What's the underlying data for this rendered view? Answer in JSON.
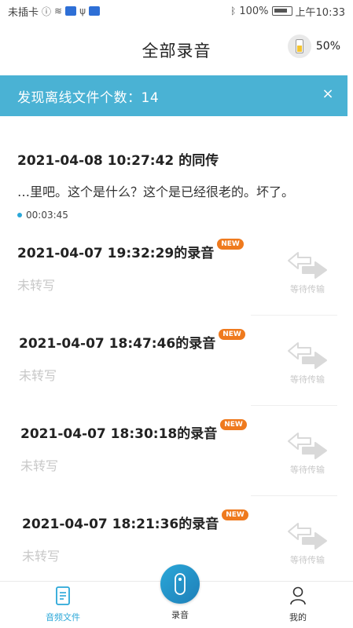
{
  "status_bar": {
    "carrier": "未插卡",
    "battery_percent": "100%",
    "time": "上午10:33"
  },
  "header": {
    "title": "全部录音",
    "device_battery": "50%",
    "device_battery_level": 0.5
  },
  "banner": {
    "text": "发现离线文件个数：14",
    "close_symbol": "×"
  },
  "first_record": {
    "title": "2021-04-08 10:27:42 的同传",
    "snippet": "…里吧。这个是什么？这个是已经很老的。坏了。",
    "duration": "00:03:45"
  },
  "records": [
    {
      "title": "2021-04-07 19:32:29的录音",
      "badge": "NEW",
      "status": "未转写",
      "transfer": "等待传输"
    },
    {
      "title": "2021-04-07 18:47:46的录音",
      "badge": "NEW",
      "status": "未转写",
      "transfer": "等待传输"
    },
    {
      "title": "2021-04-07 18:30:18的录音",
      "badge": "NEW",
      "status": "未转写",
      "transfer": "等待传输"
    },
    {
      "title": "2021-04-07 18:21:36的录音",
      "badge": "NEW",
      "status": "未转写",
      "transfer": "等待传输"
    }
  ],
  "nav": {
    "files": "音频文件",
    "record": "录音",
    "mine": "我的"
  },
  "colors": {
    "accent": "#2aa7d8",
    "banner": "#4ab2d4",
    "new_badge": "#ef7a1e"
  }
}
